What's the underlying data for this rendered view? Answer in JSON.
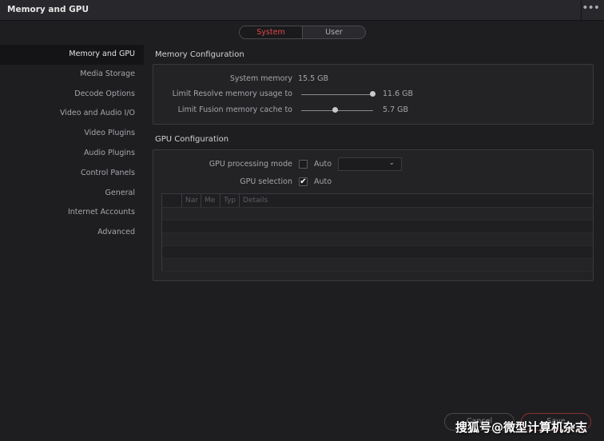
{
  "window": {
    "title": "Memory and GPU",
    "more_icon": "ellipsis-icon"
  },
  "tabs": [
    {
      "label": "System",
      "active": true
    },
    {
      "label": "User",
      "active": false
    }
  ],
  "sidebar": {
    "items": [
      {
        "label": "Memory and GPU",
        "active": true
      },
      {
        "label": "Media Storage"
      },
      {
        "label": "Decode Options"
      },
      {
        "label": "Video and Audio I/O"
      },
      {
        "label": "Video Plugins"
      },
      {
        "label": "Audio Plugins"
      },
      {
        "label": "Control Panels"
      },
      {
        "label": "General"
      },
      {
        "label": "Internet Accounts"
      },
      {
        "label": "Advanced"
      }
    ]
  },
  "memory": {
    "heading": "Memory Configuration",
    "system_label": "System memory",
    "system_value": "15.5 GB",
    "resolve_label": "Limit Resolve memory usage to",
    "resolve_value": "11.6 GB",
    "resolve_fraction": 1.0,
    "fusion_label": "Limit Fusion memory cache to",
    "fusion_value": "5.7 GB",
    "fusion_fraction": 0.45
  },
  "gpu": {
    "heading": "GPU Configuration",
    "mode_label": "GPU processing mode",
    "mode_auto": "Auto",
    "mode_checked": false,
    "selection_label": "GPU selection",
    "selection_auto": "Auto",
    "selection_checked": true,
    "check_mark": "✔",
    "dropdown_value": "",
    "columns": [
      "",
      "Nar",
      "Me",
      "Typ",
      "Details"
    ]
  },
  "footer": {
    "cancel": "Cancel",
    "save": "Save"
  },
  "watermark": "搜狐号@微型计算机杂志",
  "colors": {
    "accent": "#e04848",
    "background": "#1e1e21"
  }
}
